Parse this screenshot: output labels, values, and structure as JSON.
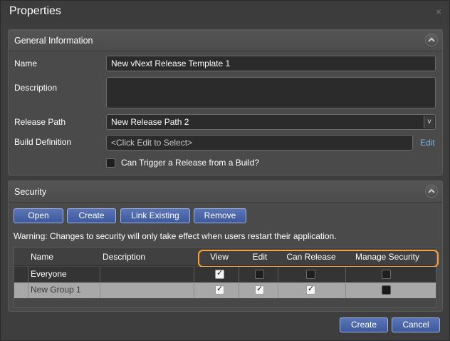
{
  "window": {
    "title": "Properties",
    "close_glyph": "×"
  },
  "general": {
    "header": "General Information",
    "name_label": "Name",
    "name_value": "New vNext Release Template 1",
    "description_label": "Description",
    "description_value": "",
    "release_path_label": "Release Path",
    "release_path_value": "New Release Path 2",
    "build_definition_label": "Build Definition",
    "build_definition_placeholder": "<Click Edit to Select>",
    "edit_link": "Edit",
    "trigger_label": "Can Trigger a Release from a Build?",
    "trigger_checked": false
  },
  "security": {
    "header": "Security",
    "buttons": {
      "open": "Open",
      "create": "Create",
      "link_existing": "Link Existing",
      "remove": "Remove"
    },
    "warning": "Warning: Changes to security will only take effect when users restart their application.",
    "columns": {
      "name": "Name",
      "description": "Description",
      "view": "View",
      "edit": "Edit",
      "can_release": "Can Release",
      "manage_security": "Manage Security"
    },
    "rows": [
      {
        "name": "Everyone",
        "description": "",
        "view": true,
        "edit": false,
        "can_release": false,
        "manage_security": false
      },
      {
        "name": "New Group 1",
        "description": "",
        "view": true,
        "edit": true,
        "can_release": true,
        "manage_security": false
      }
    ]
  },
  "footer": {
    "create": "Create",
    "cancel": "Cancel"
  },
  "colors": {
    "accent_button": "#4a65a8",
    "highlight_outline": "#f5a33c",
    "selected_row": "#a8a8a8",
    "background": "#3e3e3e"
  },
  "icons": {
    "close": "close-icon",
    "collapse": "chevron-up-icon",
    "dropdown": "chevron-down-icon",
    "check": "checkmark-icon"
  }
}
